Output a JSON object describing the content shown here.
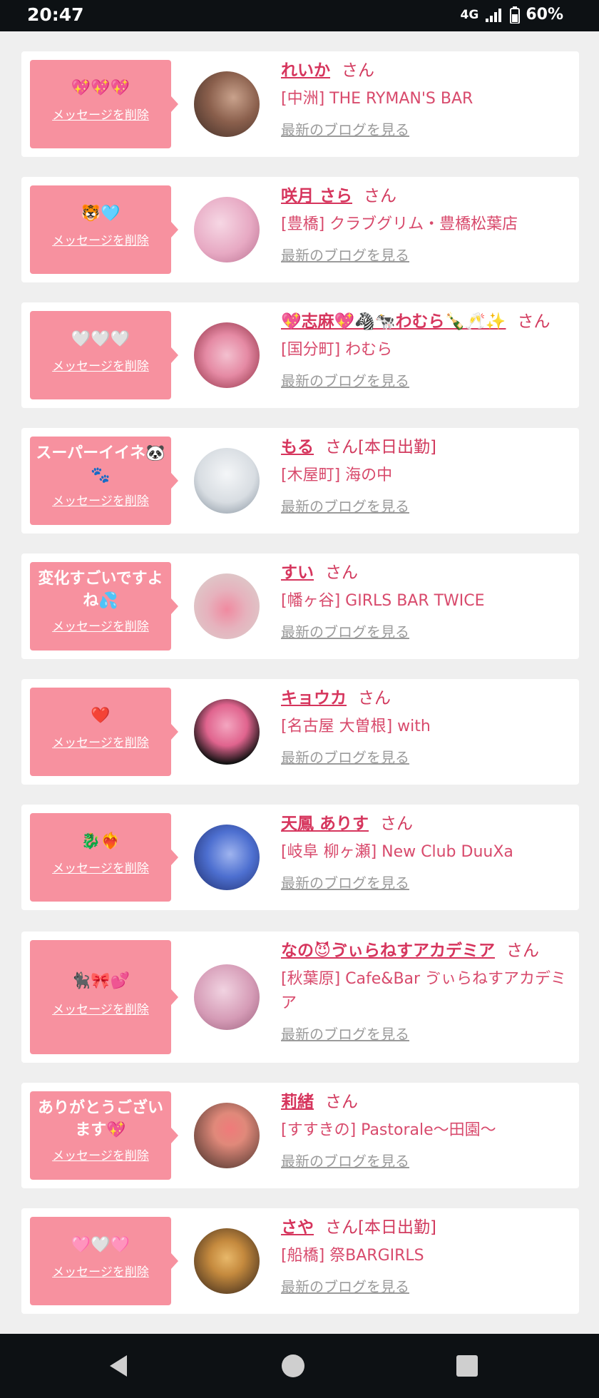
{
  "status": {
    "time": "20:47",
    "network": "4G",
    "battery": "60%"
  },
  "delete_label": "メッセージを削除",
  "blog_label": "最新のブログを見る",
  "san_label": "さん",
  "items": [
    {
      "message": "💖💖💖",
      "name": "れいか",
      "suffix": "",
      "shop": "[中洲] THE RYMAN'S BAR",
      "avatar_colors": [
        "#3b2b25",
        "#c9a28c"
      ]
    },
    {
      "message": "🐯🩵",
      "name": "咲月 さら",
      "suffix": "",
      "shop": "[豊橋] クラブグリム・豊橋松葉店",
      "avatar_colors": [
        "#e7a9c3",
        "#f6d7e4"
      ]
    },
    {
      "message": "🤍🤍🤍",
      "name": "💖志麻💖🦓🐄わむら🍾🥂✨",
      "suffix": "",
      "shop": "[国分町] わむら",
      "avatar_colors": [
        "#8a2a3e",
        "#e58aa4"
      ]
    },
    {
      "message": "スーパーイイネ🐼🐾",
      "name": "もる",
      "suffix": "[本日出勤]",
      "shop": "[木屋町] 海の中",
      "avatar_colors": [
        "#d8dde2",
        "#f4f6f8"
      ]
    },
    {
      "message": "変化すごいですよね💦",
      "name": "すい",
      "suffix": "",
      "shop": "[幡ヶ谷] GIRLS BAR TWICE",
      "avatar_colors": [
        "#d9d4cf",
        "#f08aa0"
      ]
    },
    {
      "message": "❤️",
      "name": "キョウカ",
      "suffix": "",
      "shop": "[名古屋 大曽根] with",
      "avatar_colors": [
        "#111111",
        "#f4a6c0"
      ]
    },
    {
      "message": "🐉❤️‍🔥",
      "name": "天鳳 ありす",
      "suffix": "",
      "shop": "[岐阜 柳ヶ瀬] New Club DuuXa",
      "avatar_colors": [
        "#1d2a66",
        "#4d6fd0"
      ]
    },
    {
      "message": "🐈‍⬛🎀💕",
      "name": "なの😈ゔぃらねすアカデミア",
      "suffix": "",
      "shop": "[秋葉原] Cafe&Bar ゔぃらねすアカデミア",
      "avatar_colors": [
        "#d59bb6",
        "#f1d3e1"
      ]
    },
    {
      "message": "ありがとうございます💖",
      "name": "莉緒",
      "suffix": "",
      "shop": "[すすきの] Pastorale〜田園〜",
      "avatar_colors": [
        "#3a2a24",
        "#e0897a"
      ]
    },
    {
      "message": "🩷🤍🩷",
      "name": "さや",
      "suffix": "[本日出勤]",
      "shop": "[船橋] 祭BARGIRLS",
      "avatar_colors": [
        "#2e2018",
        "#c58a3e"
      ]
    }
  ]
}
